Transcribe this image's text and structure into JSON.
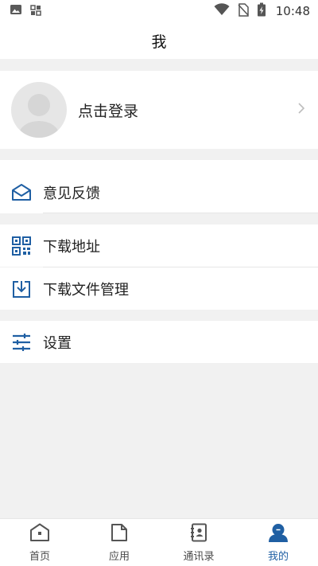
{
  "status_bar": {
    "time": "10:48",
    "icons": [
      "image-icon",
      "apps-icon",
      "wifi-icon",
      "no-sim-icon",
      "battery-charging-icon"
    ]
  },
  "header": {
    "title": "我"
  },
  "profile": {
    "login_label": "点击登录",
    "avatar_icon": "default-avatar-icon",
    "chevron_icon": "chevron-right-icon"
  },
  "menu": {
    "feedback": {
      "label": "意见反馈",
      "icon": "envelope-open-icon"
    },
    "download_address": {
      "label": "下载地址",
      "icon": "qr-code-icon"
    },
    "download_files": {
      "label": "下载文件管理",
      "icon": "download-tray-icon"
    },
    "settings": {
      "label": "设置",
      "icon": "sliders-icon"
    }
  },
  "bottom_nav": {
    "items": [
      {
        "label": "首页",
        "icon": "home-icon",
        "active": false
      },
      {
        "label": "应用",
        "icon": "document-icon",
        "active": false
      },
      {
        "label": "通讯录",
        "icon": "contacts-book-icon",
        "active": false
      },
      {
        "label": "我的",
        "icon": "user-icon",
        "active": true
      }
    ]
  },
  "colors": {
    "accent": "#1f5fa3",
    "background": "#f1f1f1",
    "card": "#ffffff",
    "text": "#222222",
    "inactive_icon": "#555555"
  }
}
